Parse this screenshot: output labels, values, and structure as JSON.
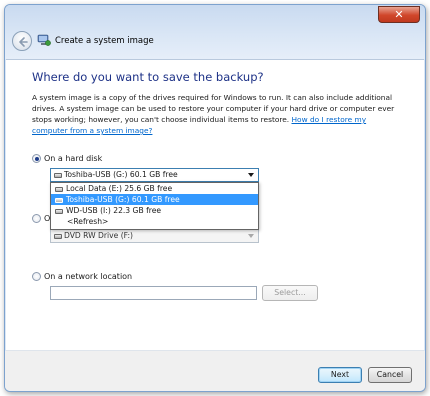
{
  "window": {
    "close_glyph": "✕"
  },
  "header": {
    "title": "Create a system image"
  },
  "main": {
    "heading": "Where do you want to save the backup?",
    "description": "A system image is a copy of the drives required for Windows to run. It can also include additional drives. A system image can be used to restore your computer if your hard drive or computer ever stops working; however, you can't choose individual items to restore.",
    "help_link": "How do I restore my computer from a system image?"
  },
  "options": {
    "hard_disk": {
      "label": "On a hard disk",
      "selected_value": "Toshiba-USB (G:)  60.1 GB free",
      "dropdown_items": [
        {
          "label": "Local Data (E:)  25.6 GB free",
          "selected": false
        },
        {
          "label": "Toshiba-USB (G:)  60.1 GB free",
          "selected": true
        },
        {
          "label": "WD-USB (I:)  22.3 GB free",
          "selected": false
        },
        {
          "label": "<Refresh>",
          "selected": false
        }
      ]
    },
    "dvd": {
      "label_partial": "O",
      "selected_value": "DVD RW Drive (F:)"
    },
    "network": {
      "label": "On a network location",
      "input_value": "",
      "select_button": "Select..."
    }
  },
  "footer": {
    "next_label": "Next",
    "cancel_label": "Cancel"
  },
  "colors": {
    "heading": "#1e3287",
    "link": "#0066cc",
    "selection": "#3399ff"
  }
}
